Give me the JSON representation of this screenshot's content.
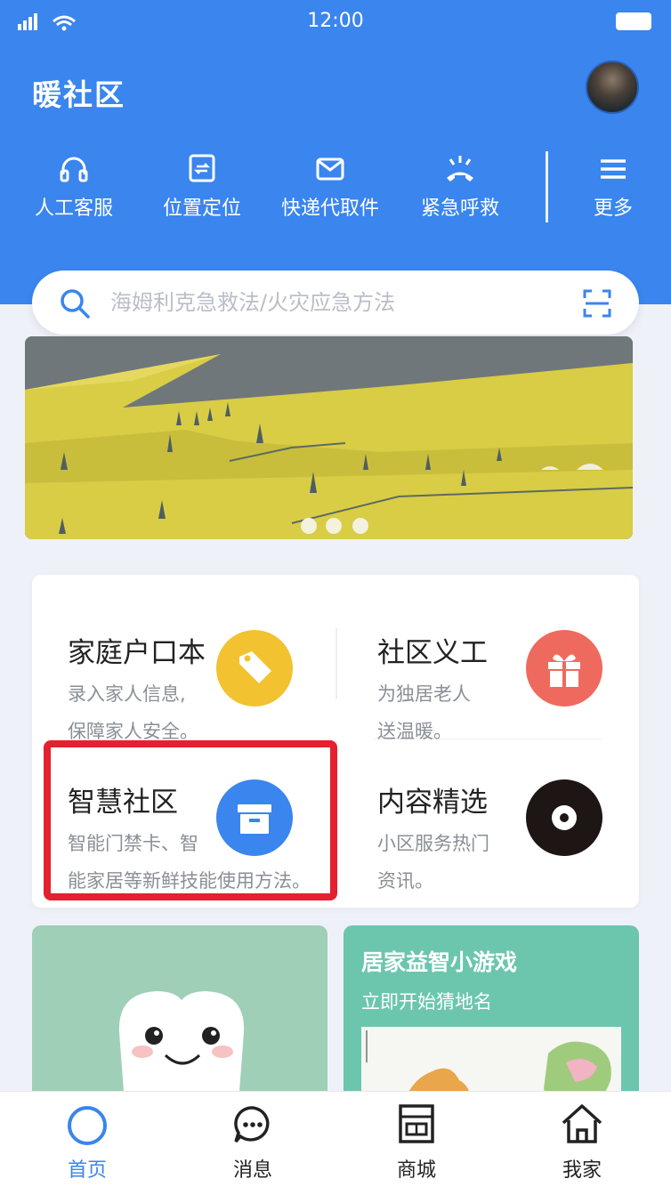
{
  "status_bar": {
    "time": "12:00",
    "signal": "ııl"
  },
  "header": {
    "title": "暖社区"
  },
  "quick_actions": [
    {
      "label": "人工客服",
      "icon": "headset-icon"
    },
    {
      "label": "位置定位",
      "icon": "location-icon"
    },
    {
      "label": "快递代取件",
      "icon": "mail-icon"
    },
    {
      "label": "紧急呼救",
      "icon": "emergency-call-icon"
    },
    {
      "label": "更多",
      "icon": "menu-icon"
    }
  ],
  "search": {
    "placeholder": "海姆利克急救法/火灾应急方法"
  },
  "banner": {
    "slide_count": 3
  },
  "services": [
    {
      "title": "家庭户口本",
      "line1": "录入家人信息,",
      "line2": "保障家人安全。",
      "icon": "tag-icon",
      "color": "#f2c230"
    },
    {
      "title": "社区义工",
      "line1": "为独居老人",
      "line2": "送温暖。",
      "icon": "gift-icon",
      "color": "#ee6a5f"
    },
    {
      "title": "智慧社区",
      "line1": "智能门禁卡、智",
      "line2": "能家居等新鲜技能使用方法。",
      "icon": "archive-box-icon",
      "color": "#3a85ee"
    },
    {
      "title": "内容精选",
      "line1": "小区服务热门",
      "line2": "资讯。",
      "icon": "vinyl-disc-icon",
      "color": "#1e1614"
    }
  ],
  "promo": {
    "right_title": "居家益智小游戏",
    "right_subtitle": "立即开始猜地名"
  },
  "tabbar": [
    {
      "label": "首页",
      "icon": "home-circle-icon",
      "active": true
    },
    {
      "label": "消息",
      "icon": "chat-bubble-icon",
      "active": false
    },
    {
      "label": "商城",
      "icon": "store-icon",
      "active": false
    },
    {
      "label": "我家",
      "icon": "house-icon",
      "active": false
    }
  ],
  "colors": {
    "primary": "#3a85ee",
    "highlight": "#e5202f",
    "background": "#eef2f8"
  }
}
